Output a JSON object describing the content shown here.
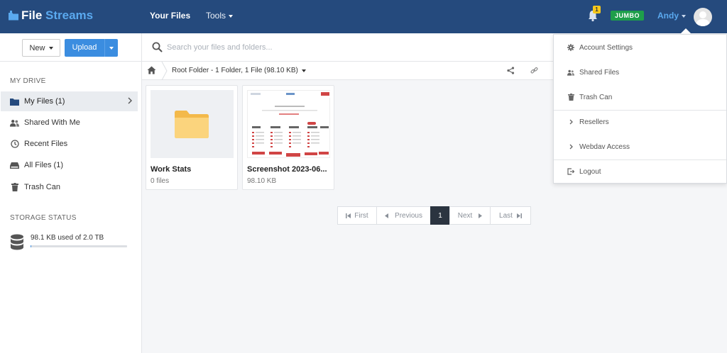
{
  "app": {
    "logo_file": "File",
    "logo_streams": "Streams"
  },
  "nav": {
    "your_files": "Your Files",
    "tools": "Tools"
  },
  "header": {
    "notification_count": "1",
    "plan_badge": "JUMBO",
    "user_name": "Andy"
  },
  "sidebar": {
    "new_label": "New",
    "upload_label": "Upload",
    "my_drive_heading": "MY DRIVE",
    "items": [
      {
        "label": "My Files (1)",
        "icon": "folder-icon"
      },
      {
        "label": "Shared With Me",
        "icon": "users-icon"
      },
      {
        "label": "Recent Files",
        "icon": "clock-icon"
      },
      {
        "label": "All Files (1)",
        "icon": "drive-icon"
      },
      {
        "label": "Trash Can",
        "icon": "trash-icon"
      }
    ],
    "storage_heading": "STORAGE STATUS",
    "storage_text": "98.1 KB used of 2.0 TB",
    "storage_fraction": 0.01
  },
  "search": {
    "placeholder": "Search your files and folders..."
  },
  "breadcrumb": {
    "text": "Root Folder - 1 Folder, 1 File (98.10 KB)"
  },
  "files": [
    {
      "name": "Work Stats",
      "meta": "0 files",
      "type": "folder"
    },
    {
      "name": "Screenshot 2023-06...",
      "meta": "98.10 KB",
      "type": "image"
    }
  ],
  "pagination": {
    "first": "First",
    "previous": "Previous",
    "current": "1",
    "next": "Next",
    "last": "Last"
  },
  "user_menu": {
    "items": [
      {
        "label": "Account Settings",
        "icon": "gear-icon"
      },
      {
        "label": "Shared Files",
        "icon": "users-icon"
      },
      {
        "label": "Trash Can",
        "icon": "trash-icon"
      },
      {
        "label": "Resellers",
        "icon": "chevron-right-icon"
      },
      {
        "label": "Webdav Access",
        "icon": "chevron-right-icon"
      },
      {
        "label": "Logout",
        "icon": "logout-icon"
      }
    ]
  },
  "colors": {
    "topbar": "#254a7d",
    "accent": "#3b8de0",
    "badge": "#1e9e4a",
    "folder": "#f9c95c"
  }
}
